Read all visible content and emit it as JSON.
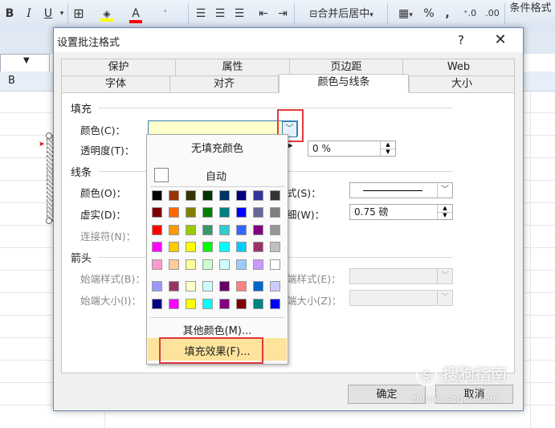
{
  "ribbon": {
    "bold": "B",
    "italic": "I",
    "underline": "U",
    "merge_center": "合并后居中",
    "percent": "%",
    "comma": ",",
    "inc_decimal": "⁺.0",
    "dec_decimal": ".00",
    "conditional_format": "条件格式"
  },
  "sheet": {
    "column_b": "B"
  },
  "dialog": {
    "title": "设置批注格式",
    "help": "?",
    "close": "✕",
    "tabs_top": [
      "保护",
      "属性",
      "页边距",
      "Web"
    ],
    "tabs_bottom": [
      "字体",
      "对齐",
      "颜色与线条",
      "大小"
    ],
    "active_tab": "颜色与线条",
    "fill": {
      "section": "填充",
      "color_label": "颜色(C)：",
      "transparency_label": "透明度(T)：",
      "transparency_value": "0 %"
    },
    "line": {
      "section": "线条",
      "color_label": "颜色(O)：",
      "dash_label": "虚实(D)：",
      "connector_label": "连接符(N)：",
      "style_label": "式(S)：",
      "weight_label": "细(W)：",
      "weight_value": "0.75 磅"
    },
    "arrows": {
      "section": "箭头",
      "begin_style": "始端样式(B)：",
      "begin_size": "始端大小(I)：",
      "end_style": "端样式(E)：",
      "end_size": "端大小(Z)："
    },
    "ok": "确定",
    "cancel": "取消"
  },
  "color_popup": {
    "no_fill": "无填充颜色",
    "automatic": "自动",
    "more_colors": "其他颜色(M)...",
    "fill_effects": "填充效果(F)...",
    "rows": [
      [
        "#000000",
        "#993300",
        "#333300",
        "#003300",
        "#003366",
        "#000080",
        "#333399",
        "#333333"
      ],
      [
        "#800000",
        "#FF6600",
        "#808000",
        "#008000",
        "#008080",
        "#0000FF",
        "#666699",
        "#808080"
      ],
      [
        "#FF0000",
        "#FF9900",
        "#99CC00",
        "#339966",
        "#33CCCC",
        "#3366FF",
        "#800080",
        "#969696"
      ],
      [
        "#FF00FF",
        "#FFCC00",
        "#FFFF00",
        "#00FF00",
        "#00FFFF",
        "#00CCFF",
        "#993366",
        "#C0C0C0"
      ],
      [
        "#FF99CC",
        "#FFCC99",
        "#FFFF99",
        "#CCFFCC",
        "#CCFFFF",
        "#99CCFF",
        "#CC99FF",
        "#FFFFFF"
      ],
      [
        "#9999FF",
        "#993366",
        "#FFFFCC",
        "#CCFFFF",
        "#660066",
        "#FF8080",
        "#0066CC",
        "#CCCCFF"
      ],
      [
        "#000080",
        "#FF00FF",
        "#FFFF00",
        "#00FFFF",
        "#800080",
        "#800000",
        "#008080",
        "#0000FF"
      ]
    ],
    "selected_fill_color": "#FFFFCC"
  },
  "watermark": {
    "brand": "搜狗指南",
    "url": "zhinan.sogou.com"
  }
}
